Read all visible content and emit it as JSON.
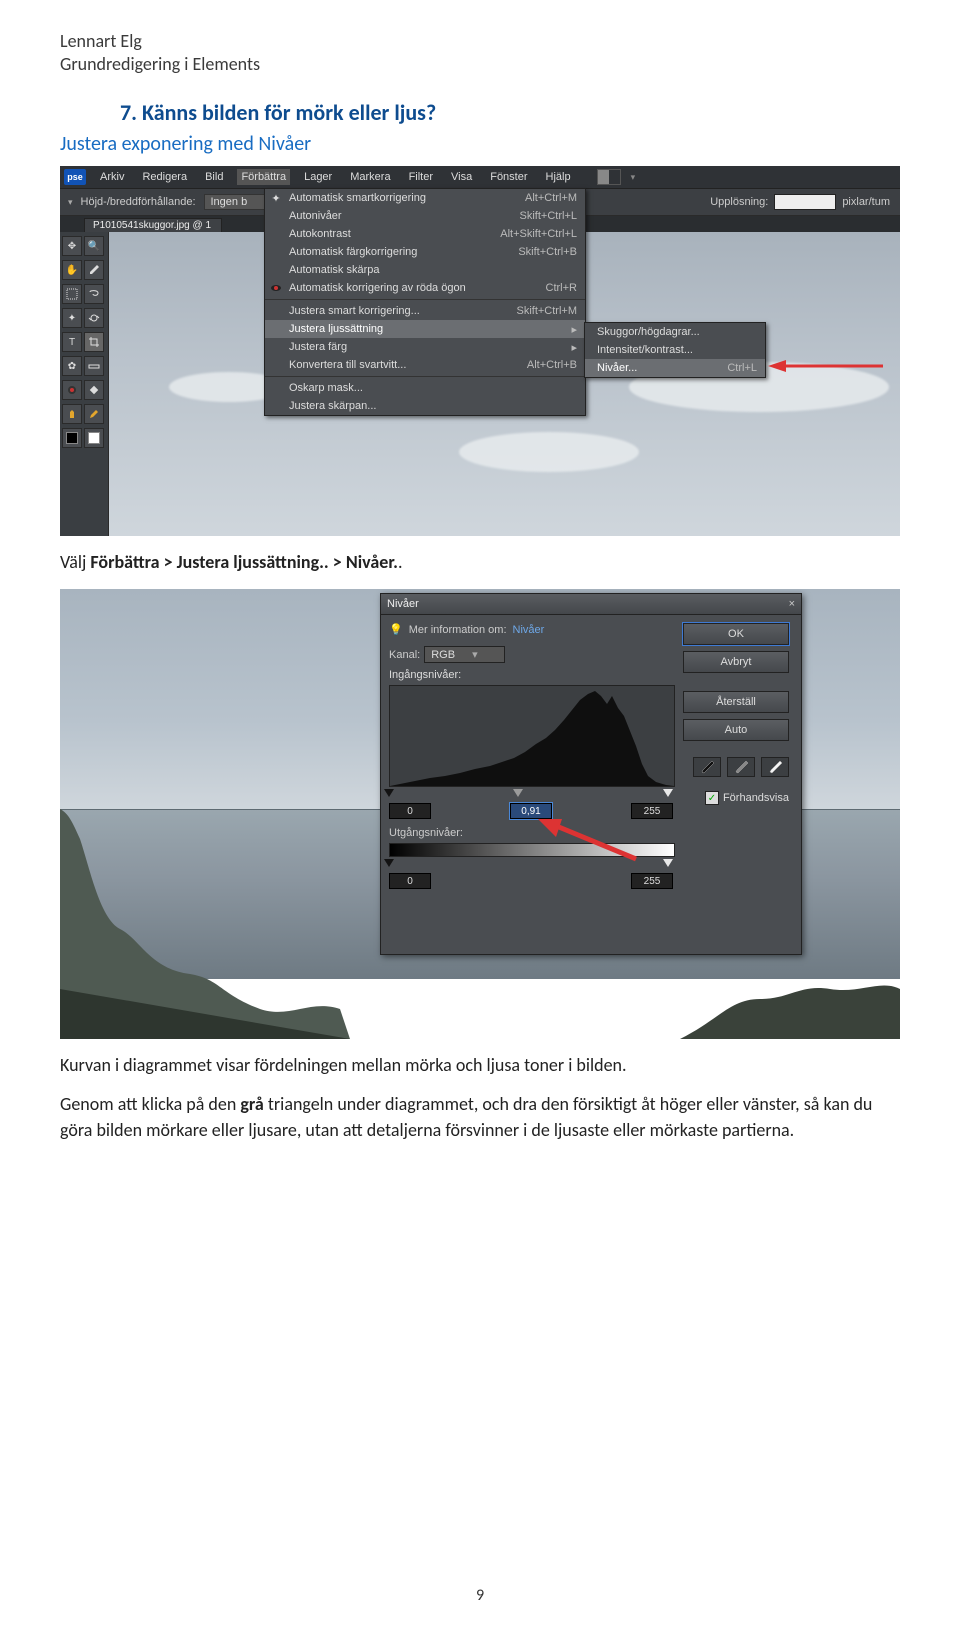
{
  "header": {
    "author": "Lennart Elg",
    "subtitle": "Grundredigering  i Elements"
  },
  "section": {
    "number": "7.",
    "title": "Känns bilden för mörk eller ljus?",
    "subheading": "Justera exponering med Nivåer"
  },
  "pse": {
    "logo": "pse",
    "menubar": [
      "Arkiv",
      "Redigera",
      "Bild",
      "Förbättra",
      "Lager",
      "Markera",
      "Filter",
      "Visa",
      "Fönster",
      "Hjälp"
    ],
    "menubar_highlight_index": 3,
    "optionbar": {
      "ratio_label": "Höjd-/breddförhållande:",
      "ratio_value": "Ingen b",
      "resolution_label": "Upplösning:",
      "px_per": "pixlar/tum"
    },
    "tab": "P1010541skuggor.jpg @ 1",
    "menu": [
      {
        "icon": "sparkle",
        "label": "Automatisk smartkorrigering",
        "shortcut": "Alt+Ctrl+M"
      },
      {
        "label": "Autonivåer",
        "shortcut": "Skift+Ctrl+L"
      },
      {
        "label": "Autokontrast",
        "shortcut": "Alt+Skift+Ctrl+L"
      },
      {
        "label": "Automatisk färgkorrigering",
        "shortcut": "Skift+Ctrl+B"
      },
      {
        "label": "Automatisk skärpa"
      },
      {
        "icon": "redeye",
        "label": "Automatisk korrigering av röda ögon",
        "shortcut": "Ctrl+R",
        "sep_after": true
      },
      {
        "label": "Justera smart korrigering...",
        "shortcut": "Skift+Ctrl+M"
      },
      {
        "label": "Justera ljussättning",
        "submenu": true,
        "highlight": true
      },
      {
        "label": "Justera färg",
        "submenu": true
      },
      {
        "label": "Konvertera till svartvitt...",
        "shortcut": "Alt+Ctrl+B",
        "sep_after": true
      },
      {
        "label": "Oskarp mask..."
      },
      {
        "label": "Justera skärpan..."
      }
    ],
    "submenu": [
      {
        "label": "Skuggor/högdagrar..."
      },
      {
        "label": "Intensitet/kontrast..."
      },
      {
        "label": "Nivåer...",
        "shortcut": "Ctrl+L",
        "highlight": true
      }
    ]
  },
  "instruction_line": {
    "prefix": "Välj ",
    "bold1": "Förbättra > Justera ljussättning.. > Nivåer.",
    "suffix": "."
  },
  "levels": {
    "title": "Nivåer",
    "info_label": "Mer information om:",
    "info_link": "Nivåer",
    "channel_label": "Kanal:",
    "channel_value": "RGB",
    "input_label": "Ingångsnivåer:",
    "in_black": "0",
    "in_mid": "0,91",
    "in_white": "255",
    "output_label": "Utgångsnivåer:",
    "out_black": "0",
    "out_white": "255",
    "buttons": {
      "ok": "OK",
      "cancel": "Avbryt",
      "reset": "Återställ",
      "auto": "Auto"
    },
    "preview": "Förhandsvisa"
  },
  "body": {
    "para1": "Kurvan i diagrammet visar fördelningen mellan mörka och ljusa toner i bilden.",
    "para2_pre": "Genom att klicka på den ",
    "para2_bold": "grå",
    "para2_post": " triangeln under diagrammet, och dra den försiktigt åt höger eller vänster, så kan du göra bilden mörkare eller ljusare, utan att detaljerna försvinner i de ljusaste eller mörkaste partierna."
  },
  "page_number": "9"
}
